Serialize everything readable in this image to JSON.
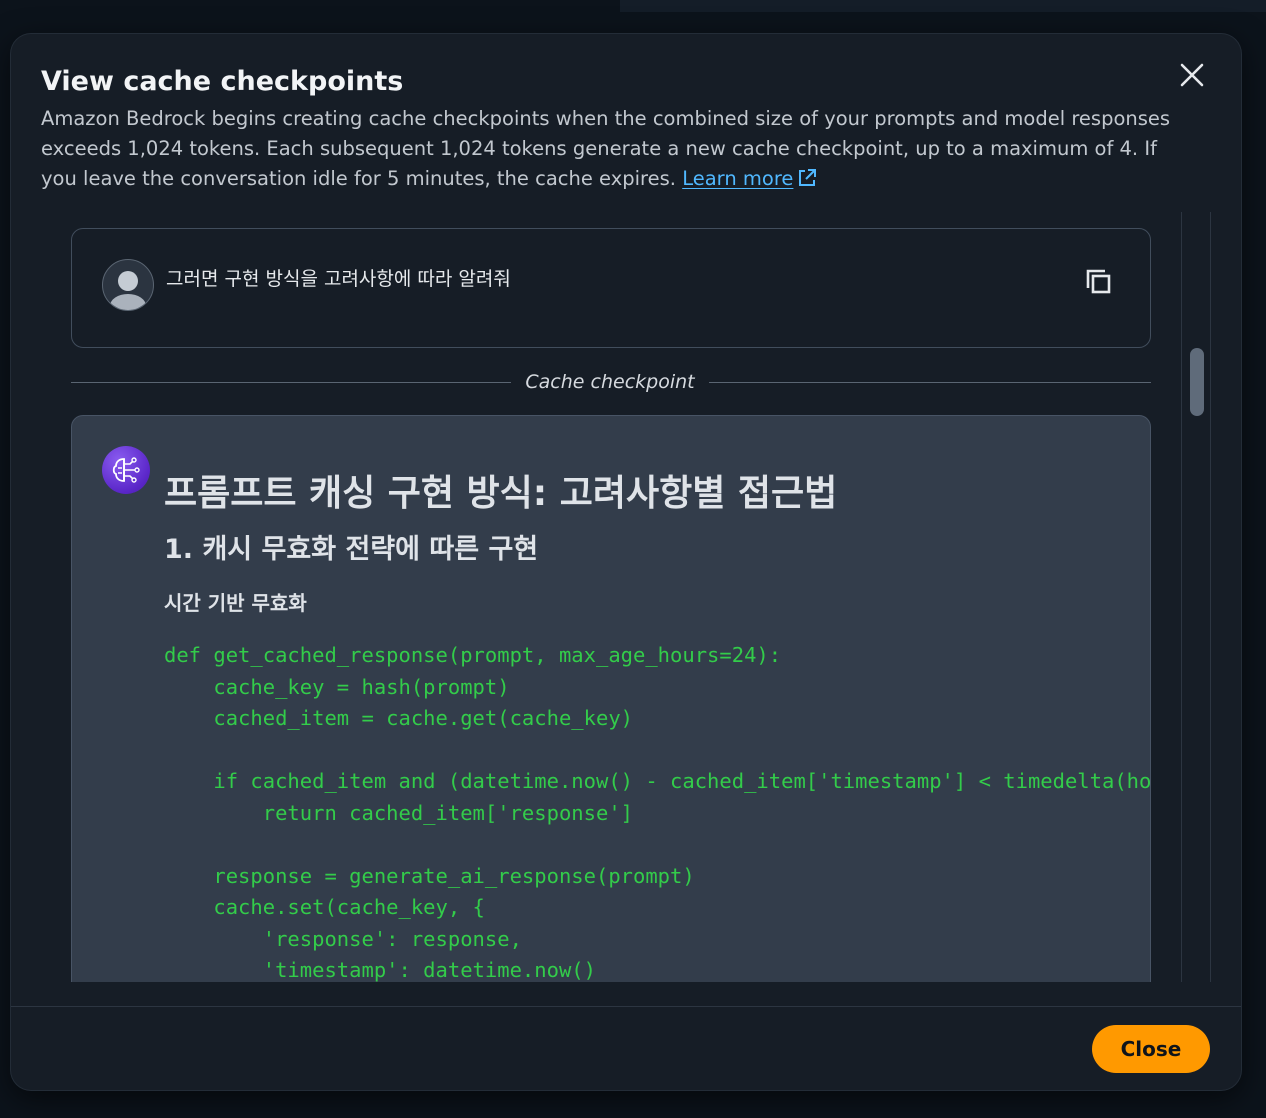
{
  "modal": {
    "title": "View cache checkpoints",
    "description": "Amazon Bedrock begins creating cache checkpoints when the combined size of your prompts and model responses exceeds 1,024 tokens. Each subsequent 1,024 tokens generate a new cache checkpoint, up to a maximum of 4. If you leave the conversation idle for 5 minutes, the cache expires.",
    "learn_more": "Learn more",
    "close_label": "Close"
  },
  "user_message": {
    "text": "그러면 구현 방식을 고려사항에 따라 알려줘"
  },
  "checkpoint_label": "Cache checkpoint",
  "ai_response": {
    "heading1": "프롬프트 캐싱 구현 방식: 고려사항별 접근법",
    "heading2": "1. 캐시 무효화 전략에 따른 구현",
    "heading3": "시간 기반 무효화",
    "code": "def get_cached_response(prompt, max_age_hours=24):\n    cache_key = hash(prompt)\n    cached_item = cache.get(cache_key)\n\n    if cached_item and (datetime.now() - cached_item['timestamp'] < timedelta(hours=max_age_hours)):\n        return cached_item['response']\n\n    response = generate_ai_response(prompt)\n    cache.set(cache_key, {\n        'response': response,\n        'timestamp': datetime.now()"
  },
  "icons": {
    "close": "close-icon",
    "external_link": "external-link-icon",
    "copy": "copy-icon",
    "user_avatar": "user-avatar-icon",
    "ai_avatar": "ai-brain-icon"
  },
  "colors": {
    "accent_button": "#ff9900",
    "link": "#50b8ff",
    "code_text": "#33cc4a",
    "ai_avatar": "#6a35d8"
  }
}
